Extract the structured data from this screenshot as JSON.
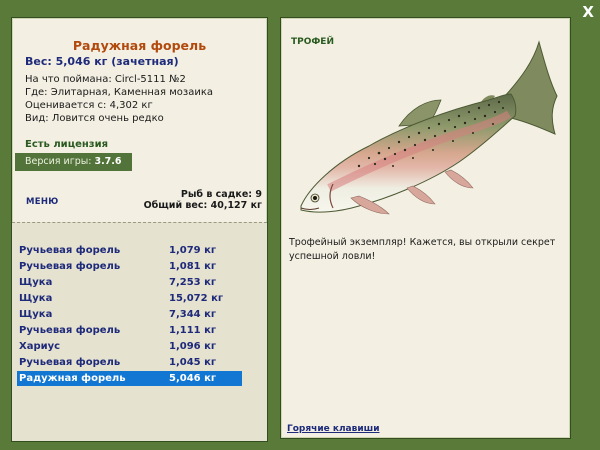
{
  "close_label": "X",
  "fish": {
    "name": "Радужная форель",
    "weight_line": "Вес: 5,046 кг (зачетная)",
    "caught_with": "На что поймана: Circl-5111 №2",
    "location": "Где: Элитарная, Каменная мозаика",
    "valued_at": "Оценивается с: 4,302 кг",
    "species_note": "Вид: Ловится очень редко"
  },
  "license": "Есть лицензия",
  "version": {
    "label": "Версия игры:",
    "value": "3.7.6"
  },
  "menu_label": "МЕНЮ",
  "keepnet": {
    "count_line": "Рыб в садке: 9",
    "total_line": "Общий вес: 40,127 кг"
  },
  "catches": [
    {
      "name": "Ручьевая форель",
      "weight": "1,079 кг",
      "selected": false
    },
    {
      "name": "Ручьевая форель",
      "weight": "1,081 кг",
      "selected": false
    },
    {
      "name": "Щука",
      "weight": "7,253 кг",
      "selected": false
    },
    {
      "name": "Щука",
      "weight": "15,072 кг",
      "selected": false
    },
    {
      "name": "Щука",
      "weight": "7,344 кг",
      "selected": false
    },
    {
      "name": "Ручьевая форель",
      "weight": "1,111 кг",
      "selected": false
    },
    {
      "name": "Хариус",
      "weight": "1,096 кг",
      "selected": false
    },
    {
      "name": "Ручьевая форель",
      "weight": "1,045 кг",
      "selected": false
    },
    {
      "name": "Радужная форель",
      "weight": "5,046 кг",
      "selected": true
    }
  ],
  "trophy": {
    "label": "ТРОФЕЙ",
    "text": "Трофейный экземпляр! Кажется, вы открыли секрет успешной ловли!",
    "image_icon": "rainbow-trout-image"
  },
  "hotkeys_label": "Горячие клавиши",
  "colors": {
    "background": "#5a7a3a",
    "panel": "#f3f0e3",
    "fish_name": "#b24a0d",
    "text_blue": "#1e2a7a",
    "selected_row": "#1277d2",
    "version_box": "#52733a"
  }
}
